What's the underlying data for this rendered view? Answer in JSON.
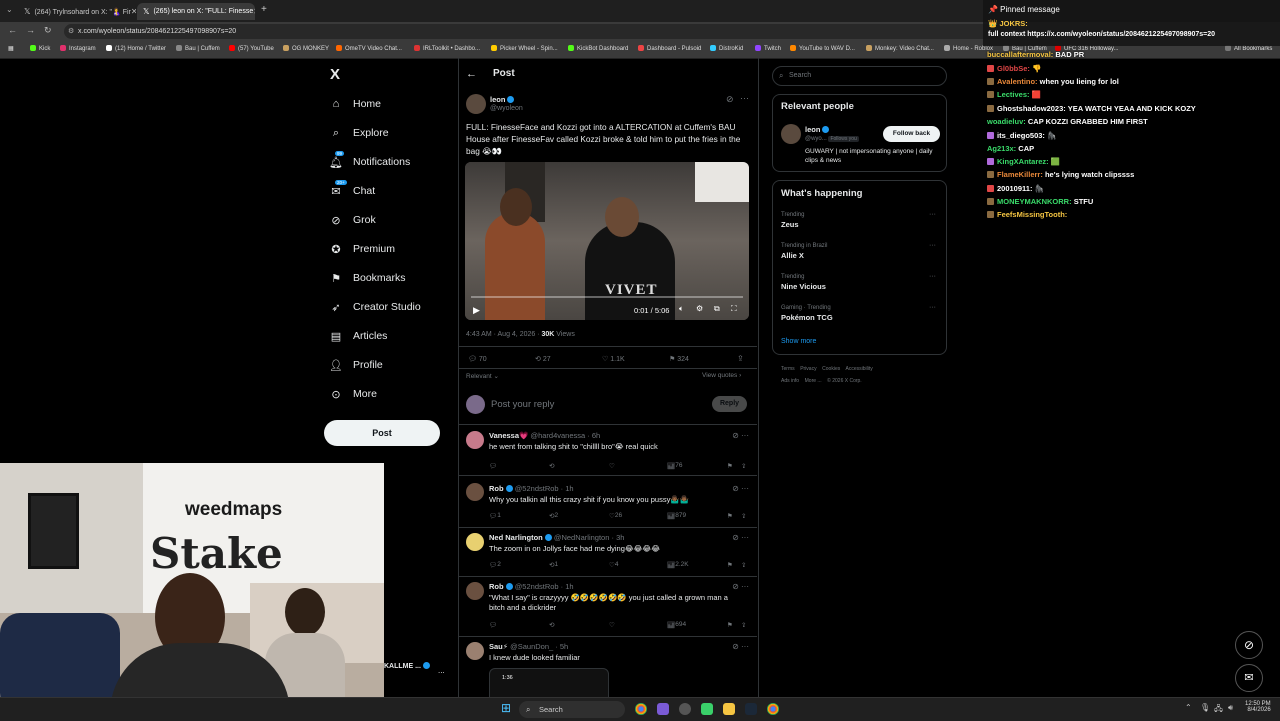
{
  "browser": {
    "tabs": [
      {
        "title": "(264) Trylnsohard on X: \"🤱 Fir",
        "active": false
      },
      {
        "title": "(265) leon on X: \"FULL: Finesse",
        "active": true
      }
    ],
    "url": "x.com/wyoleon/status/2084621225497098907s=20",
    "bookmarks": [
      "Kick",
      "Instagram",
      "(12) Home / Twitter",
      "Bau | Cuffem",
      "(57) YouTube",
      "OG MONKEY",
      "OmeTV Video Chat...",
      "IRLToolkit • Dashbo...",
      "Picker Wheel - Spin...",
      "KickBot Dashboard",
      "Dashboard - Pulsoid",
      "DistroKid",
      "Twitch",
      "YouTube to WAV D...",
      "Monkey: Video Chat...",
      "Home - Roblox",
      "Bau | Cuffem",
      "UFC 316 Holloway..."
    ],
    "all_bookmarks": "All Bookmarks"
  },
  "nav": {
    "logo": "X",
    "items": [
      {
        "label": "Home",
        "icon": "home-icon"
      },
      {
        "label": "Explore",
        "icon": "search-icon"
      },
      {
        "label": "Notifications",
        "icon": "bell-icon",
        "badge": "99"
      },
      {
        "label": "Chat",
        "icon": "chat-icon",
        "badge": "20+"
      },
      {
        "label": "Grok",
        "icon": "grok-icon"
      },
      {
        "label": "Premium",
        "icon": "premium-icon"
      },
      {
        "label": "Bookmarks",
        "icon": "bookmark-icon"
      },
      {
        "label": "Creator Studio",
        "icon": "rocket-icon"
      },
      {
        "label": "Articles",
        "icon": "articles-icon"
      },
      {
        "label": "Profile",
        "icon": "person-icon"
      },
      {
        "label": "More",
        "icon": "more-circle-icon"
      }
    ],
    "post_button": "Post",
    "account_name": "KALLME ...",
    "account_more": "..."
  },
  "post": {
    "header": "Post",
    "author_name": "leon",
    "author_handle": "@wyoleon",
    "text": "FULL: FinesseFace and Kozzi got into a ALTERCATION at Cuffem's BAU House after FinesseFav called Kozzi broke & told him to put the fries in the bag 😭👀",
    "video_time": "0:01 / 5:06",
    "video_watermark": "VIVET",
    "timestamp": "4:43 AM · Aug 4, 2026 · ",
    "views_count": "30K",
    "views_label": " Views",
    "stats": {
      "replies": "70",
      "reposts": "27",
      "likes": "1.1K",
      "bookmarks": "324"
    },
    "sort_label": "Relevant",
    "view_quotes": "View quotes",
    "reply_placeholder": "Post your reply",
    "reply_button": "Reply"
  },
  "replies": [
    {
      "name": "Vanessa💗",
      "handle": "@hard4vanessa · 6h",
      "text": "he went from talking shit to \"chillll bro\"😭 real quick",
      "reply_count": "",
      "repost_count": "",
      "like_count": "",
      "views": "76"
    },
    {
      "name": "Rob",
      "handle": "@52ndstRob · 1h",
      "text": "Why you talkin all this crazy shit if you know you pussy🤷🏾‍♂️🤷🏾‍♂️",
      "reply_count": "1",
      "repost_count": "2",
      "like_count": "26",
      "views": "879"
    },
    {
      "name": "Ned Narlington",
      "handle": "@NedNarlington · 3h",
      "text": "The zoom in on Jollys face had me dying😂😂😂😂",
      "reply_count": "2",
      "repost_count": "1",
      "like_count": "4",
      "views": "2.2K"
    },
    {
      "name": "Rob",
      "handle": "@52ndstRob · 1h",
      "text": "\"What I say\" is crazyyyy 🤣🤣🤣🤣🤣🤣 you just called a grown man a bitch and a dickrider",
      "reply_count": "",
      "repost_count": "",
      "like_count": "",
      "views": "694"
    },
    {
      "name": "Sau⚡",
      "handle": "@SaunDon_ · 5h",
      "text": "I knew dude looked familiar",
      "reply_count": "",
      "repost_count": "",
      "like_count": "",
      "views": "",
      "inner_time": "1:36"
    }
  ],
  "sidebar": {
    "search_placeholder": "Search",
    "relevant_title": "Relevant people",
    "relevant_name": "leon",
    "relevant_handle": "@wyo...",
    "follows_you": "Follows you",
    "follow_back": "Follow back",
    "relevant_bio": "GUWARY | not impersonating anyone | daily clips & news",
    "happening_title": "What's happening",
    "trends": [
      {
        "context": "Trending",
        "name": "Zeus"
      },
      {
        "context": "Trending in Brazil",
        "name": "Allie X"
      },
      {
        "context": "Trending",
        "name": "Nine Vicious"
      },
      {
        "context": "Gaming · Trending",
        "name": "Pokémon TCG"
      }
    ],
    "show_more": "Show more",
    "footer1": [
      "Terms",
      "Privacy",
      "Cookies",
      "Accessibility"
    ],
    "footer2": [
      "Ads info",
      "More ...",
      "© 2026 X Corp."
    ]
  },
  "chat": {
    "pinned": "📌 Pinned message",
    "pinned_user": "JOKRS:",
    "pinned_text": "full context https://x.com/wyoleon/status/2084621225497098907s=20",
    "messages": [
      {
        "user": "buccallaftermoval:",
        "text": "BAD PR",
        "color": "#f5c542"
      },
      {
        "user": "Gl0bbSe:",
        "text": "👎",
        "color": "#e04646"
      },
      {
        "user": "Avalentino:",
        "text": "when you lieing for lol",
        "color": "#e8883a"
      },
      {
        "user": "Lectives:",
        "text": "🟥",
        "color": "#3adb6a"
      },
      {
        "user": "Ghostshadow2023:",
        "text": "YEA WATCH YEAA AND KICK KOZY",
        "color": "#ffffff"
      },
      {
        "user": "woadieluv:",
        "text": "CAP KOZZI GRABBED HIM FIRST",
        "color": "#3adb6a"
      },
      {
        "user": "its_diego503:",
        "text": "🦍",
        "color": "#ffffff"
      },
      {
        "user": "Ag213x:",
        "text": "CAP",
        "color": "#3adb6a"
      },
      {
        "user": "KingXAntarez:",
        "text": "🟩",
        "color": "#3adb6a"
      },
      {
        "user": "FlameKillerr:",
        "text": "he's lying watch clipssss",
        "color": "#e8883a"
      },
      {
        "user": "20010911:",
        "text": "🦍",
        "color": "#ffffff"
      },
      {
        "user": "MONEYMAKNKORR:",
        "text": "STFU",
        "color": "#3adb6a"
      },
      {
        "user": "FeefsMissingTooth:",
        "text": "",
        "color": "#f5c542"
      }
    ]
  },
  "webcam": {
    "sign1": "weedmaps",
    "sign2": "Stake"
  },
  "taskbar": {
    "search_placeholder": "Search",
    "time": "12:50 PM",
    "date": "8/4/2026"
  }
}
